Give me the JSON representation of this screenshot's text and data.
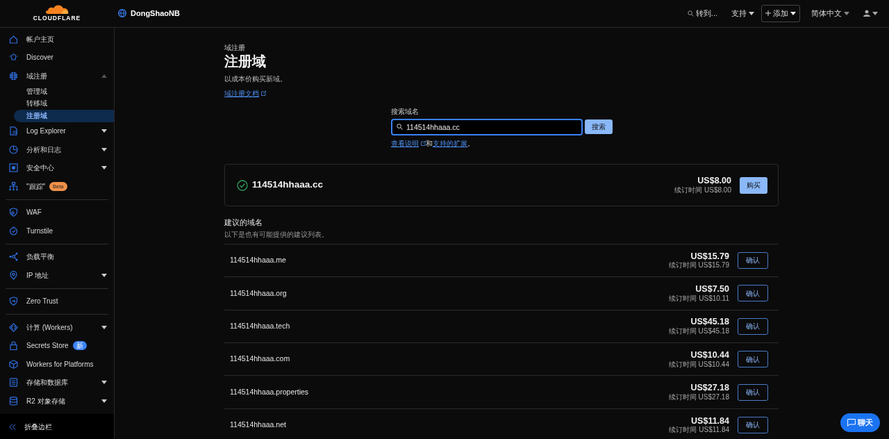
{
  "topbar": {
    "logo_text": "CLOUDFLARE",
    "account": "DongShaoNB",
    "search": "转到...",
    "support": "支持",
    "add": "添加",
    "language": "简体中文"
  },
  "sidebar": {
    "groups": [
      {
        "items": [
          {
            "label": "帐户主页"
          },
          {
            "label": "Discover"
          },
          {
            "label": "域注册",
            "expanded": true,
            "children": [
              {
                "label": "管理域",
                "selected": false
              },
              {
                "label": "转移域",
                "selected": false
              },
              {
                "label": "注册域",
                "selected": true
              }
            ]
          },
          {
            "label": "Log Explorer",
            "expanded": false
          },
          {
            "label": "分析和日志",
            "expanded": false
          },
          {
            "label": "安全中心",
            "expanded": false
          },
          {
            "label": "\"跟踪\"",
            "badge": {
              "text": "Beta",
              "kind": "beta"
            }
          }
        ]
      },
      {
        "items": [
          {
            "label": "WAF"
          },
          {
            "label": "Turnstile"
          }
        ]
      },
      {
        "items": [
          {
            "label": "负载平衡"
          },
          {
            "label": "IP 地址",
            "expanded": false
          }
        ]
      },
      {
        "items": [
          {
            "label": "Zero Trust"
          }
        ]
      },
      {
        "items": [
          {
            "label": "计算 (Workers)",
            "expanded": false
          },
          {
            "label": "Secrets Store",
            "badge": {
              "text": "新",
              "kind": "new"
            }
          },
          {
            "label": "Workers for Platforms"
          },
          {
            "label": "存储和数据库",
            "expanded": false
          },
          {
            "label": "R2 对象存储",
            "expanded": false
          }
        ]
      }
    ],
    "footer": "折叠边栏"
  },
  "page": {
    "breadcrumb": "域注册",
    "title": "注册域",
    "description": "以成本价购买新域。",
    "docs_link": "域注册文档"
  },
  "search": {
    "label": "搜索域名",
    "value": "114514hhaaa.cc",
    "button": "搜索",
    "help": [
      {
        "kind": "link",
        "text": "查看说明",
        "external": true
      },
      {
        "kind": "text",
        "text": "和"
      },
      {
        "kind": "link",
        "text": "支持的扩展",
        "external": false
      },
      {
        "kind": "text",
        "text": "。"
      }
    ]
  },
  "result": {
    "domain": "114514hhaaa.cc",
    "available": true,
    "price": "US$8.00",
    "renewal": "续订时间 US$8.00",
    "button": "购买"
  },
  "suggestions": {
    "title": "建议的域名",
    "subtitle": "以下是也有可能提供的建议列表。",
    "rows": [
      {
        "domain": "114514hhaaa.me",
        "price": "US$15.79",
        "renewal": "续订时间 US$15.79",
        "button": "确认"
      },
      {
        "domain": "114514hhaaa.org",
        "price": "US$7.50",
        "renewal": "续订时间 US$10.11",
        "button": "确认"
      },
      {
        "domain": "114514hhaaa.tech",
        "price": "US$45.18",
        "renewal": "续订时间 US$45.18",
        "button": "确认"
      },
      {
        "domain": "114514hhaaa.com",
        "price": "US$10.44",
        "renewal": "续订时间 US$10.44",
        "button": "确认"
      },
      {
        "domain": "114514hhaaa.properties",
        "price": "US$27.18",
        "renewal": "续订时间 US$27.18",
        "button": "确认"
      },
      {
        "domain": "114514hhaaa.net",
        "price": "US$11.84",
        "renewal": "续订时间 US$11.84",
        "button": "确认"
      }
    ]
  },
  "chat_button": "聊天"
}
